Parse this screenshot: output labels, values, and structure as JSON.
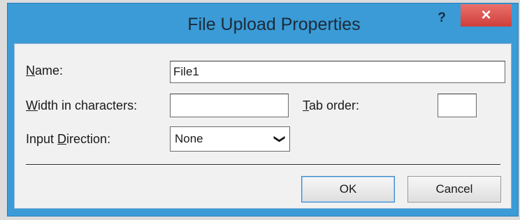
{
  "window": {
    "title": "File Upload Properties",
    "help_label": "?",
    "close_label": "×"
  },
  "form": {
    "name_label": "Name:",
    "name_label_accel": "N",
    "name_label_rest": "ame:",
    "name_value": "File1",
    "width_label_accel": "W",
    "width_label_rest": "idth in characters:",
    "width_value": "",
    "tab_order_label_accel": "T",
    "tab_order_label_rest": "ab order:",
    "tab_order_value": "",
    "direction_label_pre": "Input ",
    "direction_label_accel": "D",
    "direction_label_rest": "irection:",
    "direction_value": "None",
    "direction_arrow": "❯"
  },
  "buttons": {
    "ok_label": "OK",
    "cancel_label": "Cancel"
  },
  "colors": {
    "titlebar": "#3a9bd7",
    "close_button": "#d9534f",
    "client_bg": "#f1f1f1",
    "default_button_border": "#3c8ad0"
  }
}
